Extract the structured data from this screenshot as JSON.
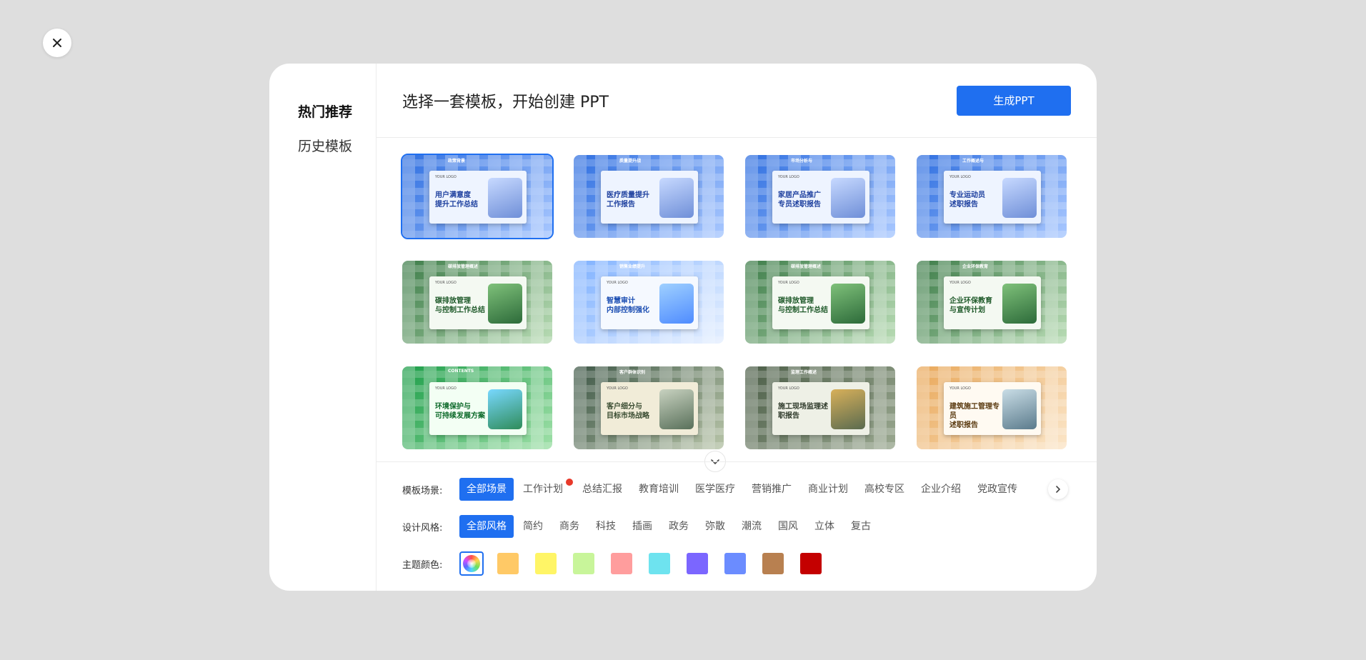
{
  "sidebar": {
    "items": [
      {
        "label": "热门推荐"
      },
      {
        "label": "历史模板"
      }
    ]
  },
  "header": {
    "title": "选择一套模板，开始创建 PPT",
    "generate_label": "生成PPT"
  },
  "templates": [
    {
      "title": "用户满意度\n提升工作总结",
      "top": "政策背景",
      "logo": "YOUR LOGO",
      "theme": "blue"
    },
    {
      "title": "医疗质量提升\n工作报告",
      "top": "质量提升战",
      "logo": "",
      "theme": "blue"
    },
    {
      "title": "家居产品推广\n专员述职报告",
      "top": "市场分析与",
      "logo": "YOUR LOGO",
      "theme": "blue"
    },
    {
      "title": "专业运动员\n述职报告",
      "top": "工作概述与",
      "logo": "YOUR LOGO",
      "theme": "blue"
    },
    {
      "title": "碳排放管理\n与控制工作总结",
      "top": "碳排放管理概述",
      "logo": "YOUR LOGO",
      "theme": "green"
    },
    {
      "title": "智慧审计\n内部控制强化",
      "top": "销售业绩提升",
      "logo": "YOUR LOGO",
      "theme": "lightblue"
    },
    {
      "title": "碳排放管理\n与控制工作总结",
      "top": "碳排放管理概述",
      "logo": "YOUR LOGO",
      "theme": "green"
    },
    {
      "title": "企业环保教育\n与宣传计划",
      "top": "企业环保教育",
      "logo": "YOUR LOGO",
      "theme": "green"
    },
    {
      "title": "环境保护与\n可持续发展方案",
      "top": "CONTENTS",
      "logo": "YOUR LOGO",
      "theme": "brightgreen"
    },
    {
      "title": "客户细分与\n目标市场战略",
      "top": "客户群体识别",
      "logo": "YOUR LOGO",
      "theme": "olive"
    },
    {
      "title": "施工现场监理述职报告",
      "top": "监理工作概述",
      "logo": "YOUR LOGO",
      "theme": "darkolive"
    },
    {
      "title": "建筑施工管理专员\n述职报告",
      "top": "",
      "logo": "YOUR LOGO",
      "theme": "orange"
    }
  ],
  "filters": {
    "scene": {
      "label": "模板场景:",
      "options": [
        "全部场景",
        "工作计划",
        "总结汇报",
        "教育培训",
        "医学医疗",
        "营销推广",
        "商业计划",
        "高校专区",
        "企业介绍",
        "党政宣传"
      ]
    },
    "style": {
      "label": "设计风格:",
      "options": [
        "全部风格",
        "简约",
        "商务",
        "科技",
        "插画",
        "政务",
        "弥散",
        "潮流",
        "国风",
        "立体",
        "复古"
      ]
    },
    "color": {
      "label": "主题颜色:",
      "swatches": [
        "#ffc966",
        "#fff566",
        "#c8f59a",
        "#ff9d9d",
        "#6ee3ef",
        "#7b66ff",
        "#6b8cff",
        "#b88050",
        "#c40000"
      ]
    }
  },
  "colors": {
    "accent": "#1f6ff0",
    "hot": "#e8392a"
  }
}
